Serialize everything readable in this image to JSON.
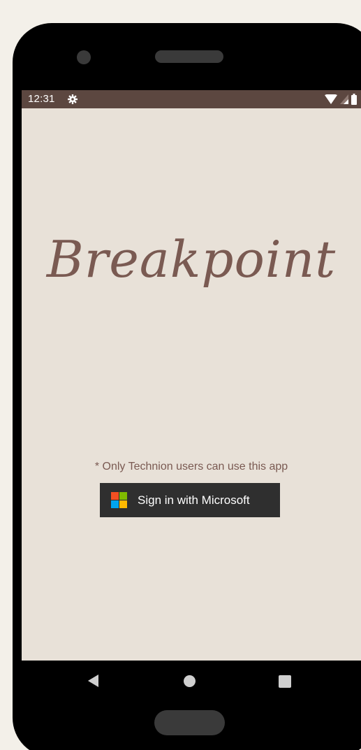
{
  "status_bar": {
    "time": "12:31",
    "icons": [
      "gear-icon",
      "wifi-icon",
      "signal-icon",
      "battery-icon"
    ]
  },
  "app": {
    "title": "Breakpoint"
  },
  "login": {
    "note": "* Only Technion users can use this app",
    "button_label": "Sign in with Microsoft",
    "logo_colors": [
      "#f25022",
      "#7fba00",
      "#00a4ef",
      "#ffb900"
    ]
  },
  "nav_bar": {
    "icons": [
      "back-icon",
      "home-icon",
      "recents-icon"
    ]
  },
  "colors": {
    "status_bar": "#5c4740",
    "background": "#e8e1d8",
    "accent_text": "#7a5a52",
    "button_bg": "#2f2f2f"
  }
}
